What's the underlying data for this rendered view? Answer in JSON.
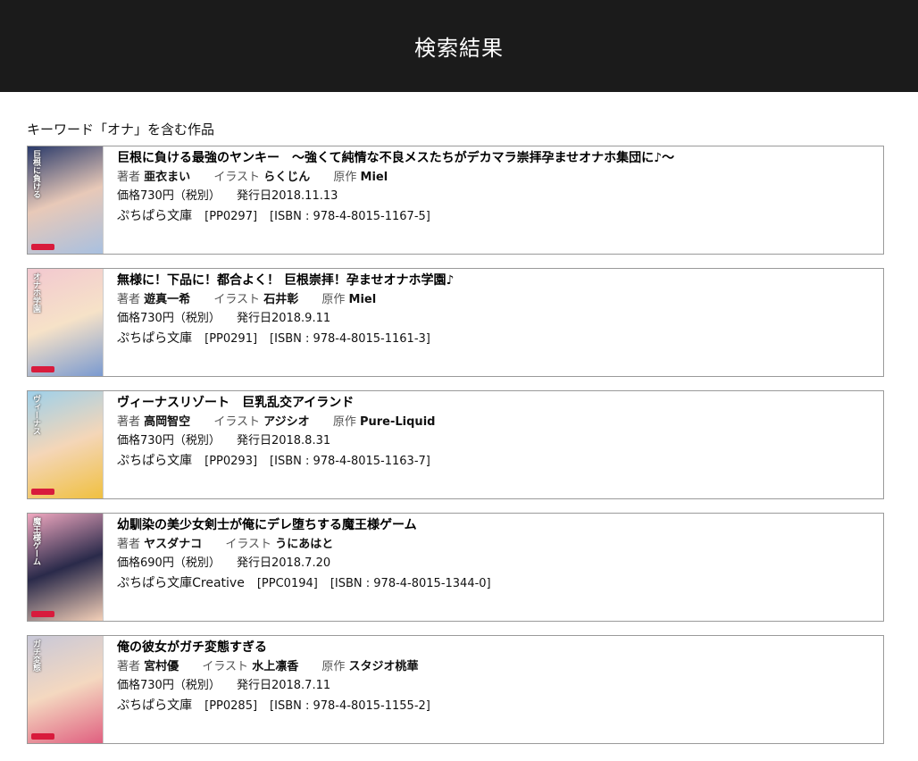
{
  "header": {
    "title": "検索結果"
  },
  "keyword_heading": "キーワード「オナ」を含む作品",
  "results": [
    {
      "title": "巨根に負ける最強のヤンキー　～強くて純情な不良メスたちがデカマラ崇拝孕ませオナホ集団に♪～",
      "author_label": "著者",
      "author": "亜衣まい",
      "illust_label": "イラスト",
      "illust": "らくじん",
      "original_label": "原作",
      "original": "Miel",
      "price": "価格730円（税別）",
      "date": "発行日2018.11.13",
      "publisher": "ぷちぱら文庫",
      "code": "[PP0297]",
      "isbn": "[ISBN : 978-4-8015-1167-5]",
      "cover_colors": [
        "#2a3a6a",
        "#e8c9b8",
        "#a8c0e0"
      ],
      "cover_label": "巨根に負ける"
    },
    {
      "title": "無様に！下品に！都合よく！ 巨根崇拝！孕ませオナホ学園♪",
      "author_label": "著者",
      "author": "遊真一希",
      "illust_label": "イラスト",
      "illust": "石井彰",
      "original_label": "原作",
      "original": "Miel",
      "price": "価格730円（税別）",
      "date": "発行日2018.9.11",
      "publisher": "ぷちぱら文庫",
      "code": "[PP0291]",
      "isbn": "[ISBN : 978-4-8015-1161-3]",
      "cover_colors": [
        "#f2c8d0",
        "#f6e2c8",
        "#7a9ad0"
      ],
      "cover_label": "オナホ学園"
    },
    {
      "title": "ヴィーナスリゾート　巨乳乱交アイランド",
      "author_label": "著者",
      "author": "高岡智空",
      "illust_label": "イラスト",
      "illust": "アジシオ",
      "original_label": "原作",
      "original": "Pure-Liquid",
      "price": "価格730円（税別）",
      "date": "発行日2018.8.31",
      "publisher": "ぷちぱら文庫",
      "code": "[PP0293]",
      "isbn": "[ISBN : 978-4-8015-1163-7]",
      "cover_colors": [
        "#9ed0ea",
        "#f4d6b8",
        "#f0c040"
      ],
      "cover_label": "ヴィーナス"
    },
    {
      "title": "幼馴染の美少女剣士が俺にデレ堕ちする魔王様ゲーム",
      "author_label": "著者",
      "author": "ヤスダナコ",
      "illust_label": "イラスト",
      "illust": "うにあはと",
      "original_label": "",
      "original": "",
      "price": "価格690円（税別）",
      "date": "発行日2018.7.20",
      "publisher": "ぷちぱら文庫Creative",
      "code": "[PPC0194]",
      "isbn": "[ISBN : 978-4-8015-1344-0]",
      "cover_colors": [
        "#f0a8c0",
        "#2a2a4a",
        "#f4d0b8"
      ],
      "cover_label": "魔王様ゲーム"
    },
    {
      "title": "俺の彼女がガチ変態すぎる",
      "author_label": "著者",
      "author": "宮村優",
      "illust_label": "イラスト",
      "illust": "水上凛香",
      "original_label": "原作",
      "original": "スタジオ桃華",
      "price": "価格730円（税別）",
      "date": "発行日2018.7.11",
      "publisher": "ぷちぱら文庫",
      "code": "[PP0285]",
      "isbn": "[ISBN : 978-4-8015-1155-2]",
      "cover_colors": [
        "#c8c8d8",
        "#f4d8c0",
        "#e06080"
      ],
      "cover_label": "ガチ変態"
    }
  ]
}
